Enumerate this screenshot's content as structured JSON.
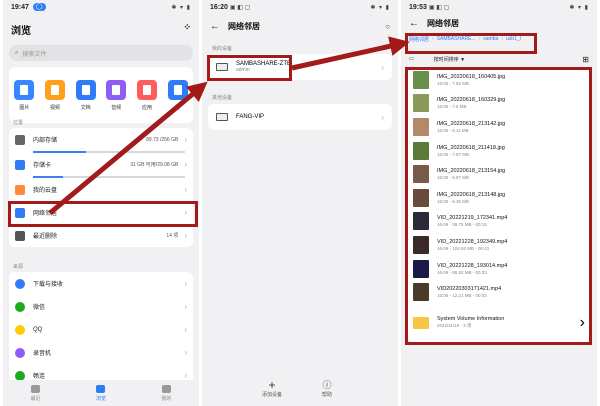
{
  "colors": {
    "accent": "#2f7cf6",
    "highlight": "#a31a1a"
  },
  "phone1": {
    "status_time": "19:47",
    "status_pill": "◯",
    "title": "浏览",
    "grid_icon": "grid-icon",
    "search_placeholder": "搜索文件",
    "categories": [
      {
        "label": "图片",
        "color": "#3a86ff"
      },
      {
        "label": "视频",
        "color": "#ff9f1c"
      },
      {
        "label": "文档",
        "color": "#2f7cf6"
      },
      {
        "label": "音频",
        "color": "#8e5cf7"
      },
      {
        "label": "应用",
        "color": "#ff5c5c"
      },
      {
        "label": "压",
        "color": "#2f7cf6"
      }
    ],
    "section_location": "位置",
    "locations": [
      {
        "label": "内部存储",
        "value": "89.73",
        "value2": "/256 GB",
        "progress": 0.35,
        "color": "#666666"
      },
      {
        "label": "存储卡",
        "value": "31 GB 可用/29.08 GB",
        "value2": "",
        "progress": 0.2,
        "color": "#2f7cf6"
      },
      {
        "label": "我的云盘",
        "value": "",
        "value2": "",
        "progress": null,
        "color": "#ff8a3d"
      },
      {
        "label": "网络邻居",
        "value": "",
        "value2": "",
        "progress": null,
        "color": "#2f7cf6"
      },
      {
        "label": "最近删除",
        "value": "14 项",
        "value2": "",
        "progress": null,
        "color": "#555555"
      }
    ],
    "section_source": "来源",
    "sources": [
      {
        "label": "下载与接收",
        "color": "#2f7cf6"
      },
      {
        "label": "微信",
        "color": "#1aad19"
      },
      {
        "label": "QQ",
        "color": "#ffcc00"
      },
      {
        "label": "录音机",
        "color": "#8e5cf7"
      },
      {
        "label": "畅连",
        "color": "#1aad19"
      }
    ],
    "nav": [
      {
        "label": "最近",
        "active": false
      },
      {
        "label": "浏览",
        "active": true
      },
      {
        "label": "我的",
        "active": false
      }
    ]
  },
  "phone2": {
    "status_time": "16:20",
    "title": "网络邻居",
    "section_mine": "我的设备",
    "device_name": "SAMBASHARE-ZTE",
    "device_user": "admin",
    "section_other": "其他设备",
    "other_device": "FANG-VIP",
    "add_label": "添加设备",
    "help_label": "帮助"
  },
  "phone3": {
    "status_time": "19:53",
    "title": "网络邻居",
    "crumbs": [
      "网络邻居",
      "SAMBASHARE...",
      "samba",
      "usb1_l"
    ],
    "sort_label": "按时间排序 ▼",
    "files": [
      {
        "name": "IMG_20220618_160405.jpg",
        "meta": "16:05 - 7.82 MB",
        "color": "#6a8f4a"
      },
      {
        "name": "IMG_20220618_160329.jpg",
        "meta": "16:05 - 7.6 MB",
        "color": "#8a9a5a"
      },
      {
        "name": "IMG_20220618_213142.jpg",
        "meta": "16:05 - 6.11 MB",
        "color": "#b08a6a"
      },
      {
        "name": "IMG_20220618_211418.jpg",
        "meta": "16:05 - 7.87 MB",
        "color": "#5a7a3a"
      },
      {
        "name": "IMG_20220618_213154.jpg",
        "meta": "16:05 - 5.97 MB",
        "color": "#7a5a4a"
      },
      {
        "name": "IMG_20220618_213148.jpg",
        "meta": "16:05 - 6.35 MB",
        "color": "#6a4a3a"
      },
      {
        "name": "VID_20221219_172341.mp4",
        "meta": "16:06 - 38.75 MB - 00:15",
        "color": "#2a2a3a"
      },
      {
        "name": "VID_20221228_192349.mp4",
        "meta": "16:06 - 104.92 MB - 00:41",
        "color": "#3a2a2a"
      },
      {
        "name": "VID_20221228_193014.mp4",
        "meta": "16:06 - 88.62 MB - 00:33",
        "color": "#1a1a4a"
      },
      {
        "name": "VID20220303171421.mp4",
        "meta": "16:06 - 12.21 MB - 00:03",
        "color": "#4a3a2a"
      }
    ],
    "folder_name": "System Volume Information",
    "folder_meta": "2022/11/18 - 3 项"
  }
}
